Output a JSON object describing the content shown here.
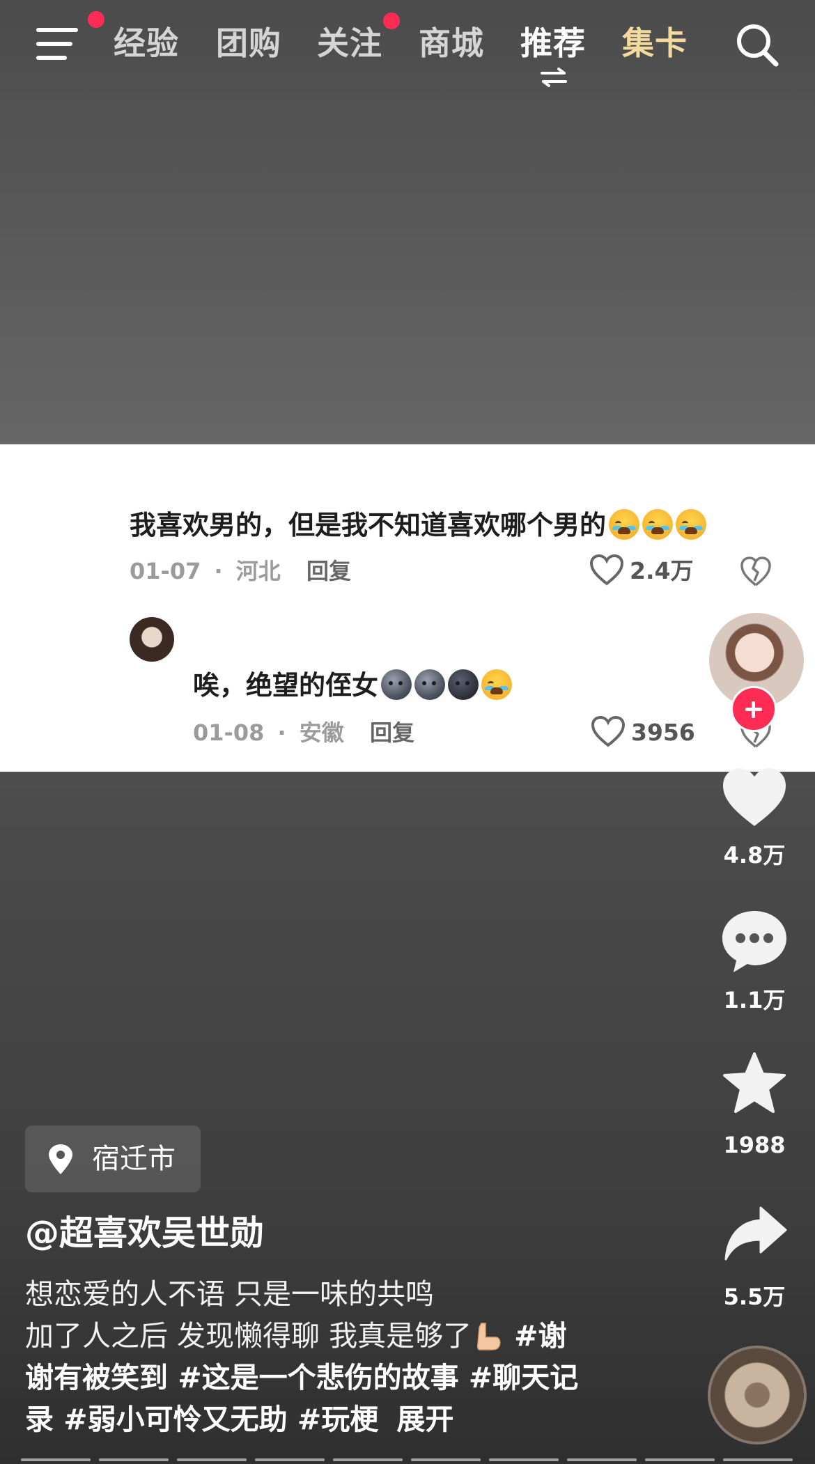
{
  "top_nav": {
    "tabs": [
      {
        "label": "经验",
        "state": "normal",
        "red_dot": false
      },
      {
        "label": "团购",
        "state": "normal",
        "red_dot": false
      },
      {
        "label": "关注",
        "state": "normal",
        "red_dot": true
      },
      {
        "label": "商城",
        "state": "normal",
        "red_dot": false
      },
      {
        "label": "推荐",
        "state": "active",
        "red_dot": false
      },
      {
        "label": "集卡",
        "state": "highlight",
        "red_dot": false
      }
    ],
    "menu_icon": "hamburger-menu-icon",
    "menu_has_red_dot": true,
    "search_icon": "search-icon",
    "active_tab_switch_icon": "swap-arrows-icon"
  },
  "comment_card": {
    "comment_1": {
      "text": "我喜欢男的，但是我不知道喜欢哪个男的",
      "emojis": [
        "loudly-crying-face",
        "loudly-crying-face",
        "loudly-crying-face"
      ],
      "date": "01-07",
      "separator": "·",
      "location": "河北",
      "reply_label": "回复",
      "likes": "2.4万"
    },
    "comment_2": {
      "text": "唉，绝望的侄女",
      "emojis": [
        "new-moon-face",
        "new-moon-face",
        "new-moon-face",
        "loudly-crying-face"
      ],
      "date": "01-08",
      "separator": "·",
      "location": "安徽",
      "reply_label": "回复",
      "likes": "3956"
    }
  },
  "actions": {
    "likes": "4.8万",
    "comments": "1.1万",
    "favorites": "1988",
    "shares": "5.5万"
  },
  "post": {
    "location": "宿迁市",
    "author": "@超喜欢吴世勋",
    "desc_line1": "想恋爱的人不语 只是一味的共鸣",
    "desc_line2_text": "加了人之后 发现懒得聊 我真是够了",
    "desc_line2_emoji": "flexed-biceps",
    "desc_line2_tag": "#谢",
    "desc_line3": "谢有被笑到 #这是一个悲伤的故事 #聊天记",
    "desc_line4_tags": "录 #弱小可怜又无助 #玩梗",
    "expand_label": "展开"
  },
  "colors": {
    "accent_red": "#fe2c55",
    "highlight_tab": "#f3dba0",
    "card_background": "#ffffff"
  }
}
